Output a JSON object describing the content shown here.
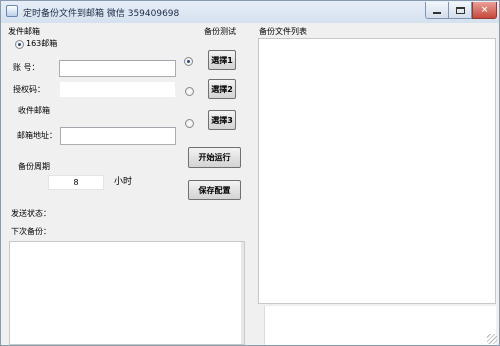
{
  "window": {
    "title": "定时备份文件到邮箱 微信 359409698",
    "controls": {
      "minimize": "",
      "maximize": "",
      "close": "×"
    }
  },
  "sender": {
    "group_label": "发件邮箱",
    "option_label": "163邮箱",
    "account_label": "账    号：",
    "account_value": "",
    "auth_label": "授权码：",
    "auth_value": ""
  },
  "receiver": {
    "group_label": "收件邮箱",
    "address_label": "邮箱地址：",
    "address_value": ""
  },
  "cycle": {
    "label": "备份周期",
    "value": "8",
    "unit": "小时"
  },
  "mode": {
    "label": "备份测试",
    "options": [
      {
        "button": "選擇1",
        "selected": true
      },
      {
        "button": "選擇2",
        "selected": false
      },
      {
        "button": "選擇3",
        "selected": false
      }
    ]
  },
  "actions": {
    "start": "开始运行",
    "save": "保存配置"
  },
  "status": {
    "send_label": "发送状态：",
    "next_label": "下次备份："
  },
  "filelist": {
    "label": "备份文件列表"
  }
}
